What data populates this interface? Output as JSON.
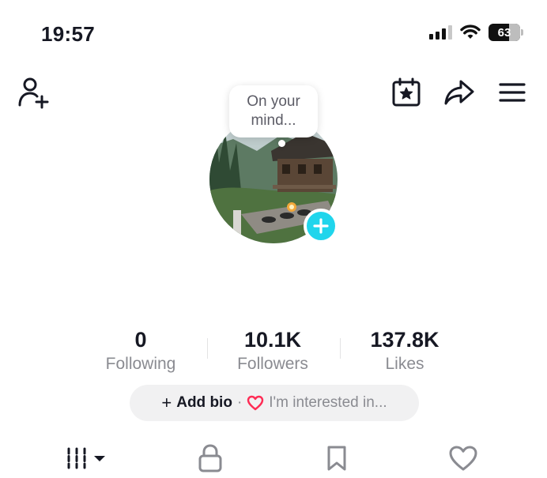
{
  "status_bar": {
    "time": "19:57",
    "battery_percent": "63"
  },
  "header": {
    "icons": [
      "add-friend-icon",
      "calendar-star-icon",
      "share-icon",
      "menu-icon"
    ],
    "bubble_text": "On your mind..."
  },
  "profile": {
    "avatar": "cabin-landscape-photo",
    "stats": [
      {
        "value": "0",
        "label": "Following"
      },
      {
        "value": "10.1K",
        "label": "Followers"
      },
      {
        "value": "137.8K",
        "label": "Likes"
      }
    ],
    "bio": {
      "add_label": "Add bio",
      "separator": "·",
      "interest_placeholder": "I'm interested in..."
    }
  },
  "tabs": [
    "videos-grid-icon",
    "lock-icon",
    "bookmark-icon",
    "heart-icon"
  ],
  "colors": {
    "accent": "#20d5ec",
    "heart": "#fe2c55",
    "text": "#161823",
    "secondary": "#8a8b91"
  }
}
